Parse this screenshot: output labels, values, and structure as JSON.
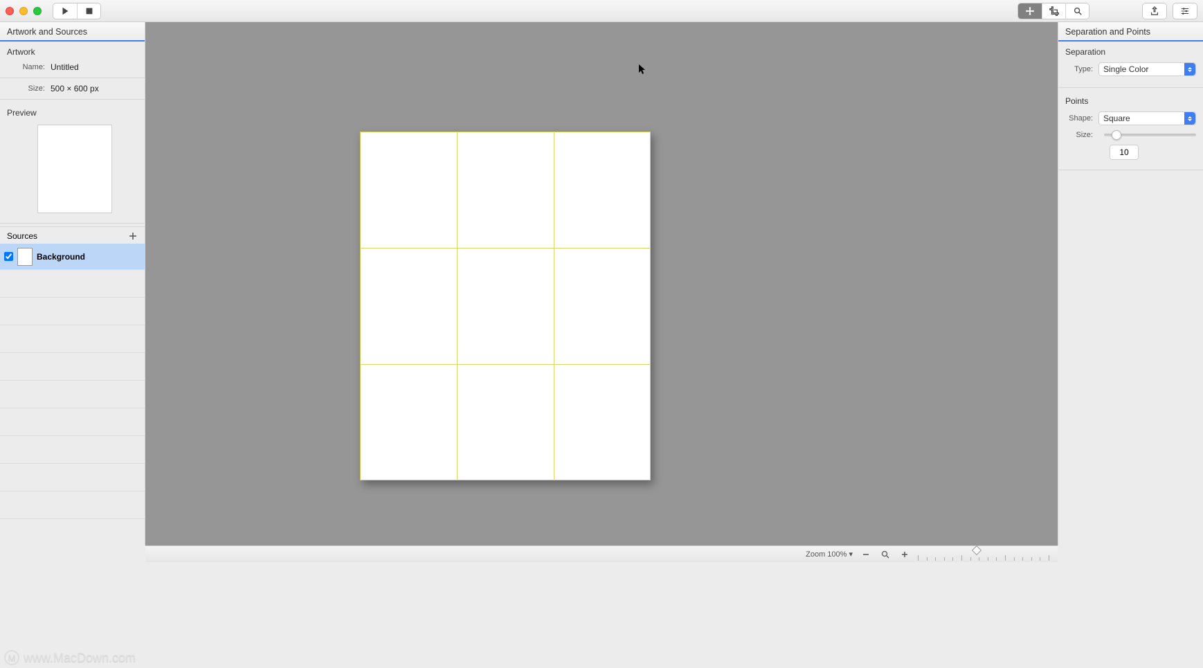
{
  "titlebar": {
    "tool_move": "move-tool",
    "tool_crop": "crop-tool",
    "tool_search": "search-tool",
    "tool_export": "export-tool",
    "tool_settings": "settings-tool"
  },
  "left_panel": {
    "header": "Artwork and Sources",
    "artwork_section": "Artwork",
    "name_label": "Name:",
    "name_value": "Untitled",
    "size_label": "Size:",
    "size_value": "500 × 600 px",
    "preview_section": "Preview",
    "sources_section": "Sources",
    "sources": [
      {
        "name": "Background",
        "checked": true
      }
    ]
  },
  "right_panel": {
    "header": "Separation and Points",
    "separation_section": "Separation",
    "type_label": "Type:",
    "type_value": "Single Color",
    "points_section": "Points",
    "shape_label": "Shape:",
    "shape_value": "Square",
    "size_label": "Size:",
    "size_input": "10",
    "size_slider_pct": 8
  },
  "canvas": {
    "artboard_w": 500,
    "artboard_h": 600
  },
  "bottom": {
    "zoom_label": "Zoom 100% ▾"
  },
  "watermark": "www.MacDown.com"
}
